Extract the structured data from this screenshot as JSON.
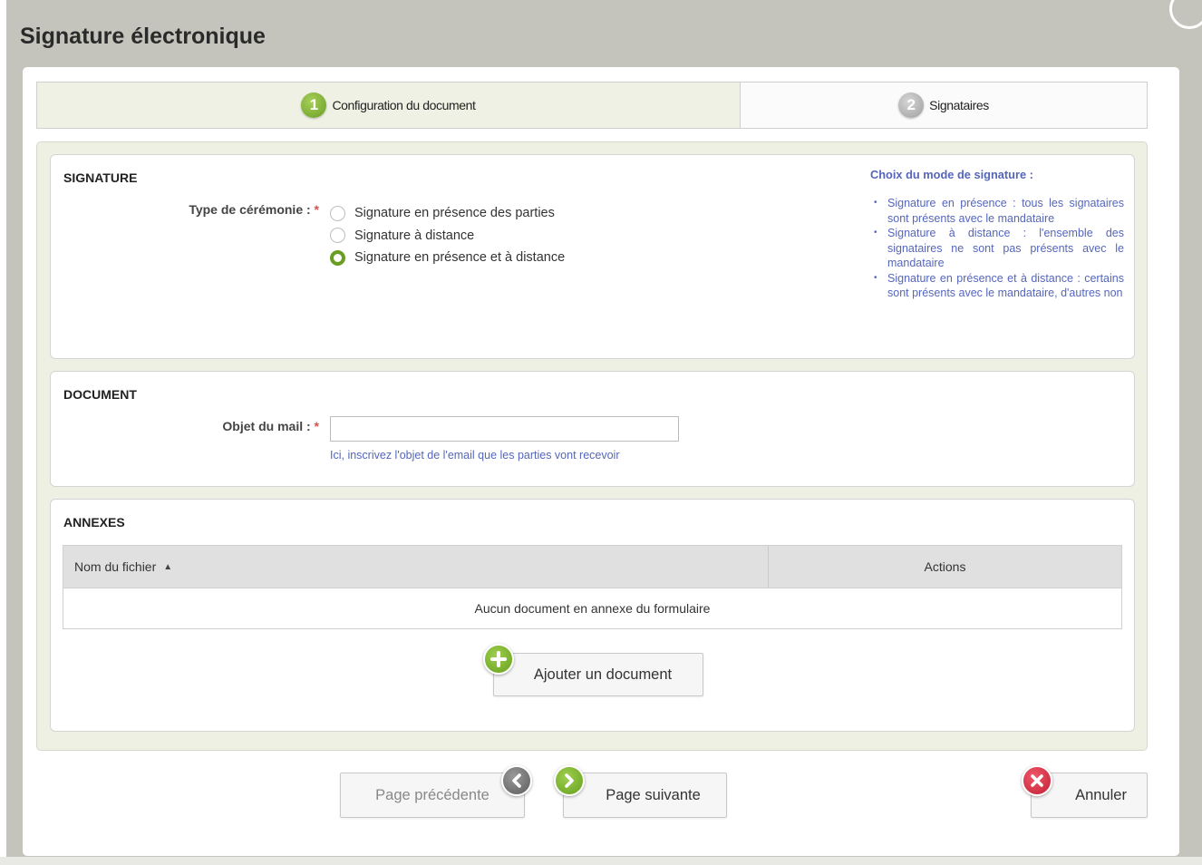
{
  "dialog": {
    "title": "Signature électronique"
  },
  "steps": [
    {
      "number": "1",
      "label": "Configuration du document",
      "active": true
    },
    {
      "number": "2",
      "label": "Signataires",
      "active": false
    }
  ],
  "signature_section": {
    "title": "SIGNATURE",
    "field_label": "Type de cérémonie :",
    "required_mark": "*",
    "options": [
      {
        "label": "Signature en présence des parties",
        "checked": false
      },
      {
        "label": "Signature à distance",
        "checked": false
      },
      {
        "label": "Signature en présence et à distance",
        "checked": true
      }
    ],
    "help": {
      "title": "Choix du mode de signature :",
      "items": [
        "Signature en présence : tous les signataires sont présents avec le mandataire",
        "Signature à distance : l'ensemble des signataires ne sont pas présents avec le mandataire",
        "Signature en présence et à distance : certains sont présents avec le mandataire, d'autres non"
      ]
    }
  },
  "document_section": {
    "title": "DOCUMENT",
    "field_label": "Objet du mail :",
    "required_mark": "*",
    "value": "",
    "hint": "Ici, inscrivez l'objet de l'email que les parties vont recevoir"
  },
  "annexes_section": {
    "title": "ANNEXES",
    "columns": [
      "Nom du fichier",
      "Actions"
    ],
    "empty_text": "Aucun document en annexe du formulaire",
    "add_button": "Ajouter un document"
  },
  "footer": {
    "prev_label": "Page précédente",
    "next_label": "Page suivante",
    "cancel_label": "Annuler"
  },
  "colors": {
    "accent_green": "#6a9e22",
    "help_blue": "#5566bb",
    "required_red": "#d9534f",
    "cancel_red": "#c21d33"
  }
}
